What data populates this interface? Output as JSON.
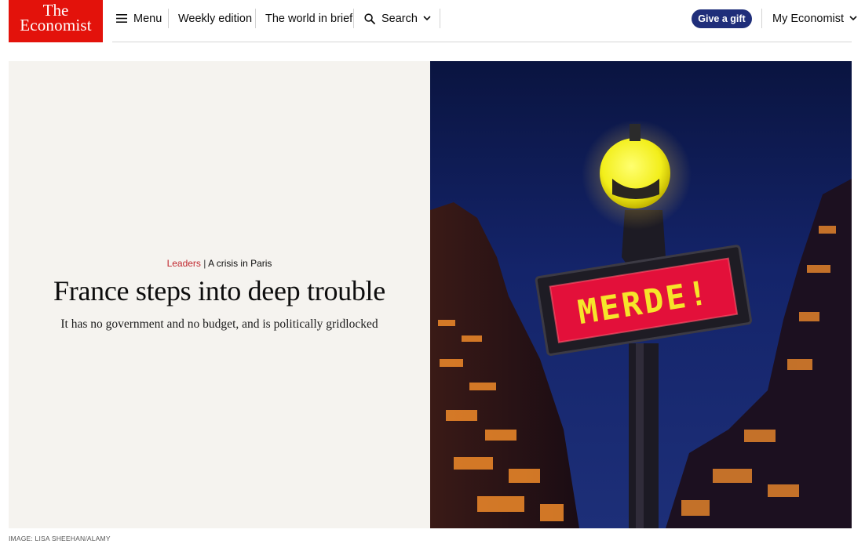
{
  "brand": {
    "line1": "The",
    "line2": "Economist",
    "color": "#e3120b"
  },
  "nav": {
    "menu": "Menu",
    "weekly": "Weekly edition",
    "brief": "The world in brief",
    "search": "Search",
    "gift": "Give a gift",
    "account": "My Economist",
    "gift_color": "#1f2e7a"
  },
  "article": {
    "section": "Leaders",
    "divider": "|",
    "flytitle": "A crisis in Paris",
    "headline": "France steps into deep trouble",
    "standfirst": "It has no government and no budget, and is politically gridlocked",
    "image_sign_text": "MERDE!",
    "credit": "IMAGE: LISA SHEEHAN/ALAMY"
  }
}
